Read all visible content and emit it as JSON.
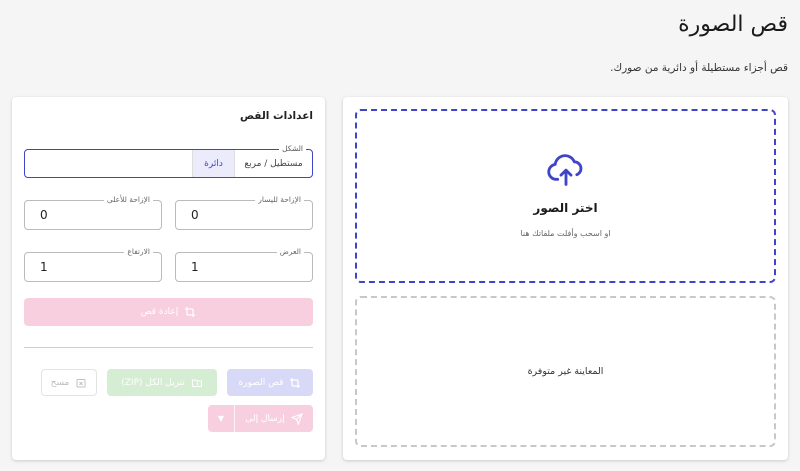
{
  "header": {
    "title": "قص الصورة",
    "description": "قص أجزاء مستطيلة أو دائرية من صورك."
  },
  "settings": {
    "title": "اعدادات القص",
    "shape": {
      "label": "الشكل",
      "options": [
        "مستطيل / مربع",
        "دائرة"
      ],
      "selected": "دائرة"
    },
    "fields": {
      "left_offset": {
        "label": "الإزاحة لليسار",
        "value": "0"
      },
      "top_offset": {
        "label": "الإزاحة للأعلى",
        "value": "0"
      },
      "width": {
        "label": "العرض",
        "value": "1"
      },
      "height": {
        "label": "الارتفاع",
        "value": "1"
      }
    },
    "buttons": {
      "recrop": "إعادة قص",
      "crop_image": "قص الصورة",
      "download_zip": "تنزيل الكل (ZIP)",
      "clear": "مسح",
      "send_to": "إرسال إلى"
    }
  },
  "upload": {
    "title": "اختر الصور",
    "subtitle": "او اسحب وأفلت ملفاتك هنا",
    "preview_empty": "المعاينة غير متوفرة"
  },
  "colors": {
    "accent": "#3f45c8",
    "pink_disabled": "#f8cfdf",
    "green_disabled": "#d5edd3",
    "indigo_disabled": "#d8d9f7"
  }
}
